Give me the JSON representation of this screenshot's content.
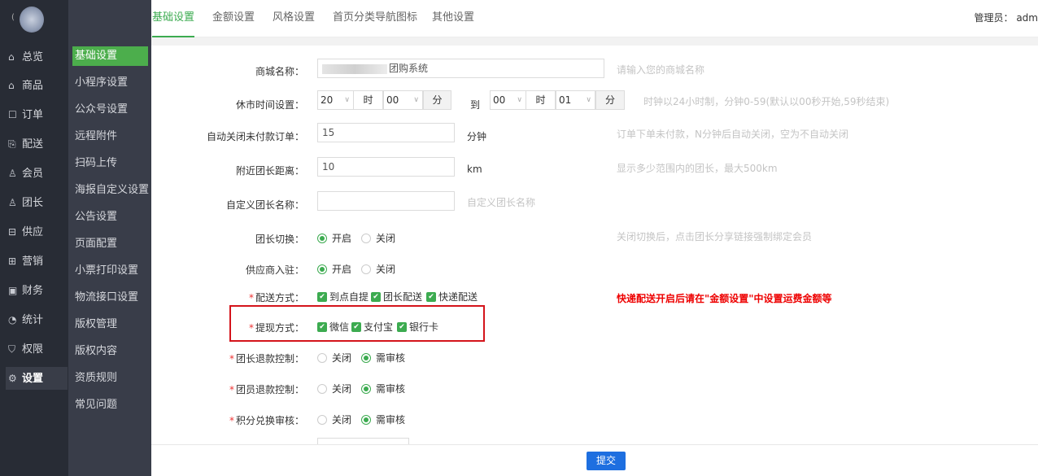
{
  "app": {
    "admin_label": "管理员：",
    "admin_name": "adm"
  },
  "colors": {
    "primary": "#3cab50",
    "sidebar": "#282c35",
    "subnav": "#393d49",
    "submit": "#1e6fe0",
    "warning": "#e00000"
  },
  "nav": [
    {
      "icon": "home-icon",
      "glyph": "⌂",
      "label": "总览"
    },
    {
      "icon": "goods-icon",
      "glyph": "⌂",
      "label": "商品"
    },
    {
      "icon": "order-icon",
      "glyph": "☐",
      "label": "订单"
    },
    {
      "icon": "delivery-icon",
      "glyph": "⎘",
      "label": "配送"
    },
    {
      "icon": "member-icon",
      "glyph": "♙",
      "label": "会员"
    },
    {
      "icon": "leader-icon",
      "glyph": "♙",
      "label": "团长"
    },
    {
      "icon": "supply-icon",
      "glyph": "⊟",
      "label": "供应"
    },
    {
      "icon": "marketing-icon",
      "glyph": "⊞",
      "label": "营销"
    },
    {
      "icon": "finance-icon",
      "glyph": "▣",
      "label": "财务"
    },
    {
      "icon": "stats-icon",
      "glyph": "◔",
      "label": "统计"
    },
    {
      "icon": "permission-icon",
      "glyph": "⛉",
      "label": "权限"
    },
    {
      "icon": "gear-icon",
      "glyph": "⚙",
      "label": "设置"
    }
  ],
  "subnav": [
    "基础设置",
    "小程序设置",
    "公众号设置",
    "远程附件",
    "扫码上传",
    "海报自定义设置",
    "公告设置",
    "页面配置",
    "小票打印设置",
    "物流接口设置",
    "版权管理",
    "版权内容",
    "资质规则",
    "常见问题"
  ],
  "tabs": [
    "基础设置",
    "金额设置",
    "风格设置",
    "首页分类导航图标",
    "其他设置"
  ],
  "form": {
    "shop_name": {
      "label": "商城名称：",
      "value": "团购系统",
      "hint": "请输入您的商城名称"
    },
    "closing_time": {
      "label": "休市时间设置：",
      "start_hour": "20",
      "hour_unit": "时",
      "start_min": "00",
      "min_unit": "分",
      "to": "到",
      "end_hour": "00",
      "end_min": "01",
      "hint": "时钟以24小时制，分钟0-59(默认以00秒开始,59秒结束)"
    },
    "auto_close": {
      "label": "自动关闭未付款订单：",
      "value": "15",
      "unit": "分钟",
      "hint": "订单下单未付款，N分钟后自动关闭，空为不自动关闭"
    },
    "leader_distance": {
      "label": "附近团长距离：",
      "value": "10",
      "unit": "km",
      "hint": "显示多少范围内的团长，最大500km"
    },
    "leader_name": {
      "label": "自定义团长名称：",
      "value": "",
      "hint": "自定义团长名称"
    },
    "leader_switch": {
      "label": "团长切换：",
      "on": "开启",
      "off": "关闭",
      "hint": "关闭切换后，点击团长分享链接强制绑定会员"
    },
    "supplier_join": {
      "label": "供应商入驻：",
      "on": "开启",
      "off": "关闭"
    },
    "delivery": {
      "label": "配送方式：",
      "options": [
        "到点自提",
        "团长配送",
        "快递配送"
      ],
      "warning": "快递配送开启后请在\"金额设置\"中设置运费金额等"
    },
    "withdraw": {
      "label": "提现方式：",
      "options": [
        "微信",
        "支付宝",
        "银行卡"
      ]
    },
    "leader_refund": {
      "label": "团长退款控制：",
      "off": "关闭",
      "review": "需审核"
    },
    "member_refund": {
      "label": "团员退款控制：",
      "off": "关闭",
      "review": "需审核"
    },
    "points_review": {
      "label": "积分兑换审核：",
      "off": "关闭",
      "review": "需审核"
    }
  },
  "footer": {
    "submit": "提交"
  }
}
